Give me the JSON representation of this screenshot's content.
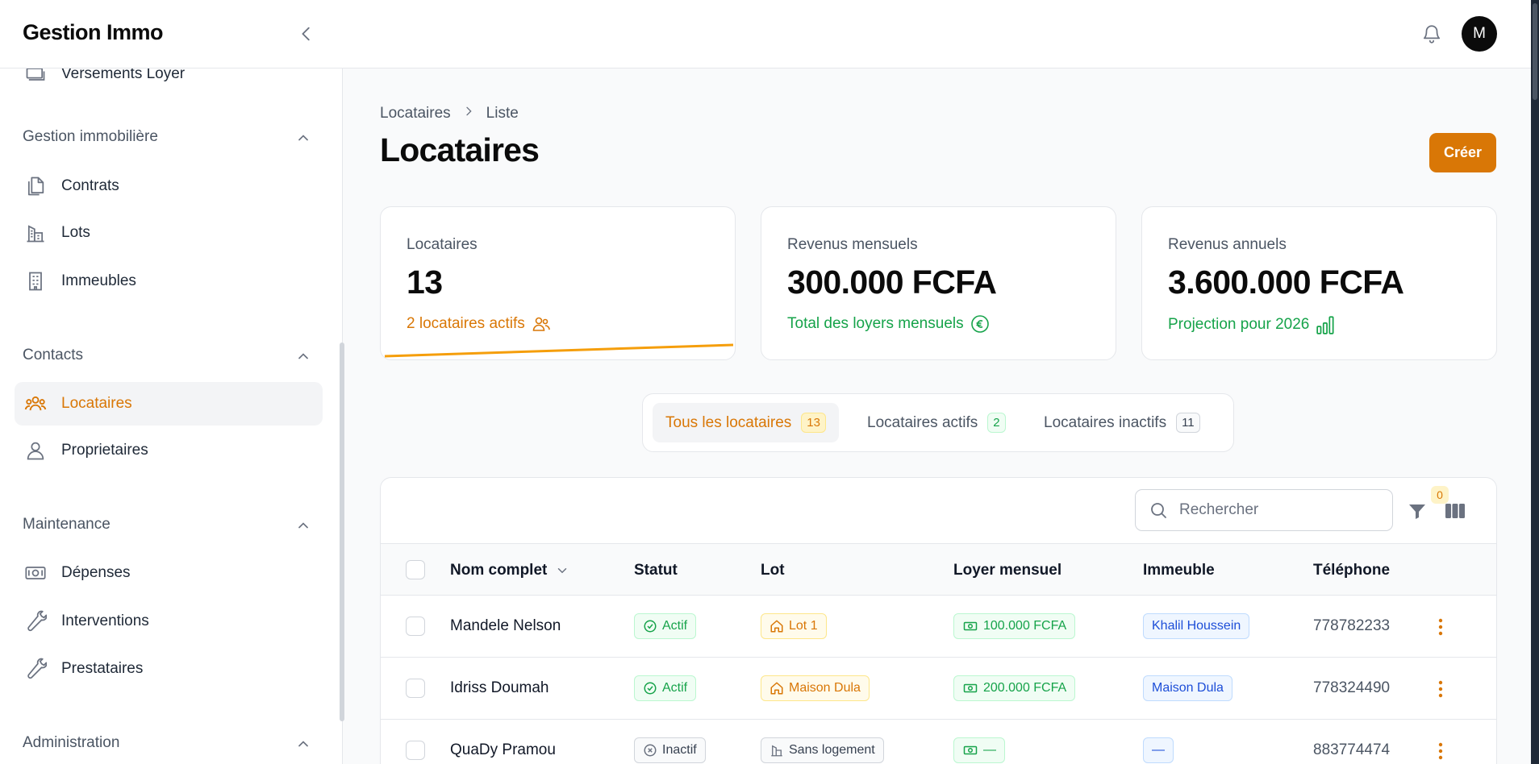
{
  "app": {
    "brand": "Gestion Immo",
    "avatar_initial": "M",
    "accent": "#d97706"
  },
  "sidebar": {
    "partial_item": "Versements Loyer",
    "groups": [
      {
        "title": "Gestion immobilière",
        "items": [
          {
            "label": "Contrats",
            "icon": "documents-icon"
          },
          {
            "label": "Lots",
            "icon": "buildings-icon"
          },
          {
            "label": "Immeubles",
            "icon": "building-icon"
          }
        ]
      },
      {
        "title": "Contacts",
        "items": [
          {
            "label": "Locataires",
            "icon": "users-icon",
            "active": true
          },
          {
            "label": "Proprietaires",
            "icon": "user-icon"
          }
        ]
      },
      {
        "title": "Maintenance",
        "items": [
          {
            "label": "Dépenses",
            "icon": "banknote-icon"
          },
          {
            "label": "Interventions",
            "icon": "wrench-icon"
          },
          {
            "label": "Prestataires",
            "icon": "wrench-icon"
          }
        ]
      },
      {
        "title": "Administration",
        "items": []
      }
    ]
  },
  "breadcrumb": {
    "parent": "Locataires",
    "current": "Liste"
  },
  "page": {
    "title": "Locataires",
    "create_label": "Créer"
  },
  "stats": [
    {
      "label": "Locataires",
      "value": "13",
      "sub": "2 locataires actifs",
      "sub_color": "orange",
      "icon": "users-icon"
    },
    {
      "label": "Revenus mensuels",
      "value": "300.000 FCFA",
      "sub": "Total des loyers mensuels",
      "sub_color": "green",
      "icon": "euro-circle-icon"
    },
    {
      "label": "Revenus annuels",
      "value": "3.600.000 FCFA",
      "sub": "Projection pour 2026",
      "sub_color": "green",
      "icon": "bar-chart-icon"
    }
  ],
  "tabs": [
    {
      "label": "Tous les locataires",
      "count": "13",
      "active": true
    },
    {
      "label": "Locataires actifs",
      "count": "2"
    },
    {
      "label": "Locataires inactifs",
      "count": "11"
    }
  ],
  "table": {
    "search_placeholder": "Rechercher",
    "filter_count": "0",
    "columns": [
      "Nom complet",
      "Statut",
      "Lot",
      "Loyer mensuel",
      "Immeuble",
      "Téléphone"
    ],
    "rows": [
      {
        "name": "Mandele Nelson",
        "status": "Actif",
        "lot": "Lot 1",
        "rent": "100.000 FCFA",
        "building": "Khalil Houssein",
        "phone": "778782233"
      },
      {
        "name": "Idriss Doumah",
        "status": "Actif",
        "lot": "Maison Dula",
        "rent": "200.000 FCFA",
        "building": "Maison Dula",
        "phone": "778324490"
      },
      {
        "name": "QuaDy Pramou",
        "status": "Inactif",
        "lot": "Sans logement",
        "rent": "—",
        "building": "—",
        "phone": "883774474"
      }
    ]
  }
}
